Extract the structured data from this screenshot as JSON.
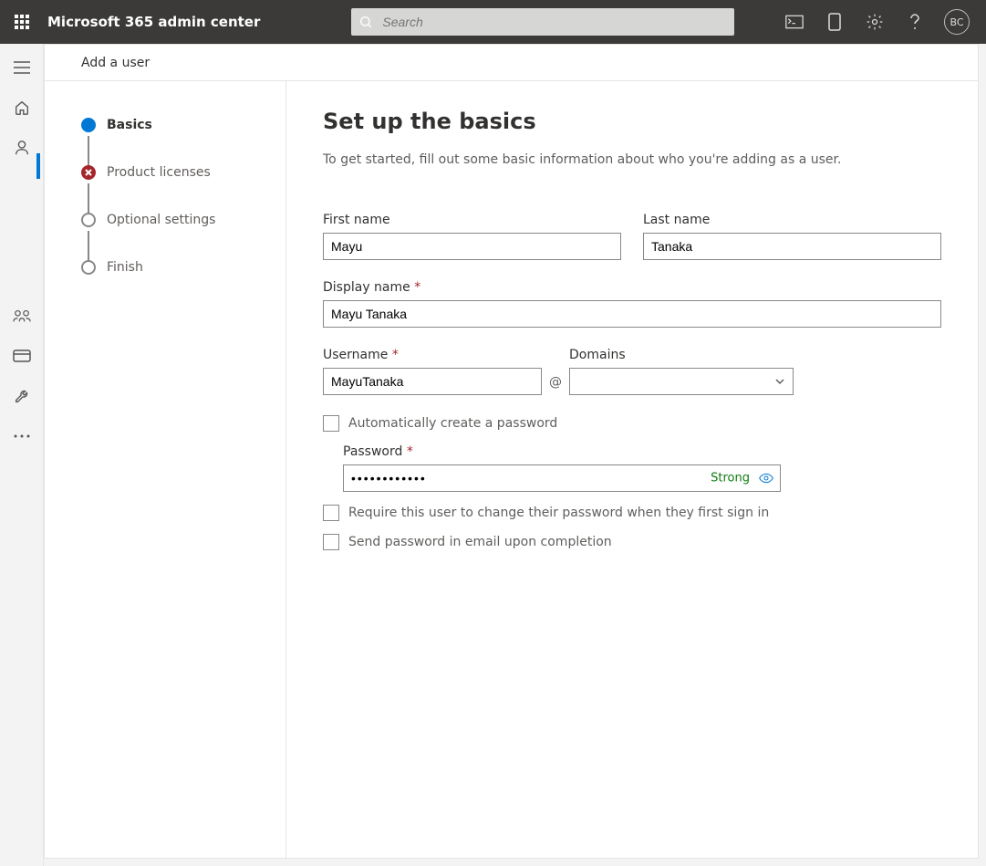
{
  "topbar": {
    "title": "Microsoft 365 admin center",
    "search_placeholder": "Search",
    "avatar_initials": "BC"
  },
  "panel": {
    "header_title": "Add a user"
  },
  "stepper": {
    "step1": "Basics",
    "step2": "Product licenses",
    "step3": "Optional settings",
    "step4": "Finish"
  },
  "form": {
    "title": "Set up the basics",
    "description": "To get started, fill out some basic information about who you're adding as a user.",
    "first_name_label": "First name",
    "first_name_value": "Mayu",
    "last_name_label": "Last name",
    "last_name_value": "Tanaka",
    "display_name_label": "Display name",
    "display_name_value": "Mayu Tanaka",
    "username_label": "Username",
    "username_value": "MayuTanaka",
    "at_symbol": "@",
    "domains_label": "Domains",
    "domains_value": "",
    "auto_pw_label": "Automatically create a password",
    "password_label": "Password",
    "password_value": "••••••••••••",
    "password_strength": "Strong",
    "require_change_label": "Require this user to change their password when they first sign in",
    "send_email_label": "Send password in email upon completion"
  }
}
